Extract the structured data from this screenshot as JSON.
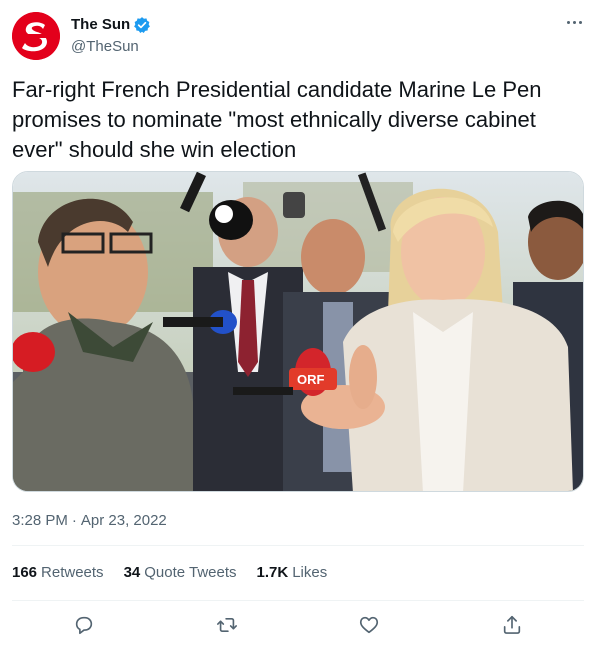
{
  "author": {
    "display_name": "The Sun",
    "handle": "@TheSun",
    "verified": true,
    "avatar_icon": "the-sun-logo"
  },
  "tweet": {
    "text": "Far-right French Presidential candidate Marine Le Pen promises to nominate \"most ethnically diverse cabinet ever\" should she win election",
    "time": "3:28 PM",
    "separator": "·",
    "date": "Apr 23, 2022"
  },
  "media": {
    "mic_labels": [
      "ORF"
    ]
  },
  "stats": {
    "retweets_count": "166",
    "retweets_label": "Retweets",
    "quote_count": "34",
    "quote_label": "Quote Tweets",
    "likes_count": "1.7K",
    "likes_label": "Likes"
  },
  "actions": [
    "reply-icon",
    "retweet-icon",
    "like-icon",
    "share-icon"
  ],
  "colors": {
    "brand_red": "#e3001b",
    "verified_blue": "#1d9bf0",
    "text_primary": "#0f1419",
    "text_secondary": "#536471"
  }
}
